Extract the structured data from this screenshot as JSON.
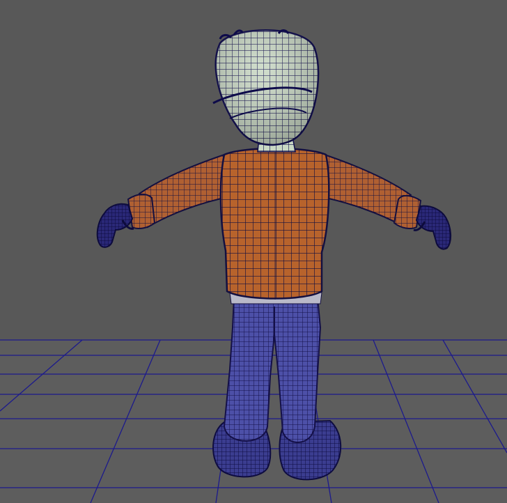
{
  "viewport": {
    "background_color": "#585858",
    "floor_color": "#5e5e5e",
    "grid_color": "#1c1a8c",
    "projection": "perspective",
    "view": "back",
    "shading": "wireframe-on-shaded"
  },
  "character": {
    "pose": "T-pose",
    "wire_color": "#0e0b4a",
    "colors": {
      "head": "#c9d8c4",
      "jacket": "#b8632c",
      "pants": "#4d50a8",
      "gloves": "#1d1b60",
      "shoes": "#3b3d90"
    }
  }
}
